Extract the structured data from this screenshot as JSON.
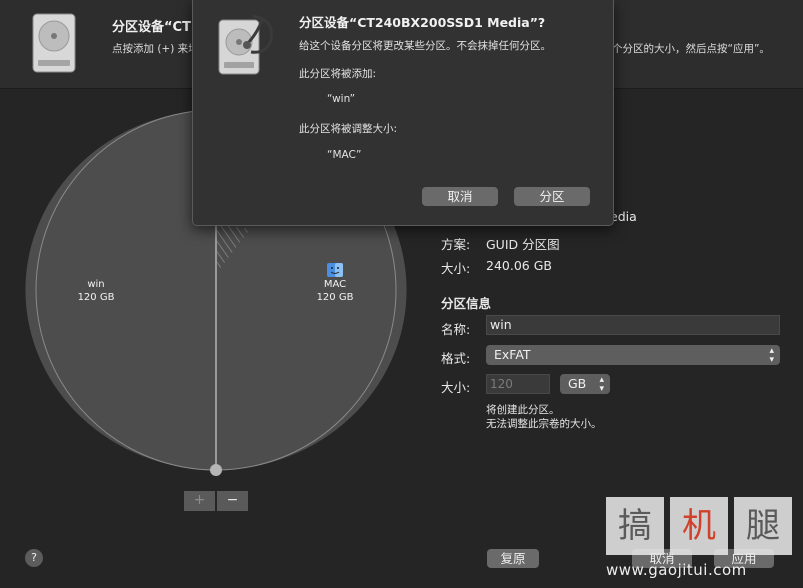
{
  "header": {
    "title": "分区设备“CT",
    "subtitle": "点按添加 (+) 来增",
    "subtitle_right": "个分区的大小，然后点按“应用”。",
    "icon": "hard-drive-icon"
  },
  "pie": {
    "segments": [
      {
        "name": "win",
        "size": "120 GB"
      },
      {
        "name": "MAC",
        "size": "120 GB",
        "icon": "finder-icon"
      }
    ],
    "add_label": "+",
    "remove_label": "−"
  },
  "info": {
    "media_partial": "edia",
    "scheme_label": "方案:",
    "scheme_value": "GUID 分区图",
    "size_label": "大小:",
    "size_value": "240.06 GB"
  },
  "partition_info": {
    "section_title": "分区信息",
    "name_label": "名称:",
    "name_value": "win",
    "format_label": "格式:",
    "format_value": "ExFAT",
    "size_label": "大小:",
    "size_placeholder": "120",
    "unit_value": "GB",
    "note_line1": "将创建此分区。",
    "note_line2": "无法调整此宗卷的大小。"
  },
  "bottom": {
    "help_label": "?",
    "revert_label": "复原",
    "cancel_label": "取消",
    "apply_label": "应用"
  },
  "dialog": {
    "title": "分区设备“CT240BX200SSD1 Media”?",
    "message": "给这个设备分区将更改某些分区。不会抹掉任何分区。",
    "add_heading": "此分区将被添加:",
    "add_item": "“win”",
    "resize_heading": "此分区将被调整大小:",
    "resize_item": "“MAC”",
    "cancel_label": "取消",
    "partition_label": "分区",
    "icon": "disk-utility-stethoscope-icon"
  },
  "watermark": {
    "chars": [
      "搞",
      "机",
      "腿"
    ],
    "url": "www.gaojitui.com"
  }
}
